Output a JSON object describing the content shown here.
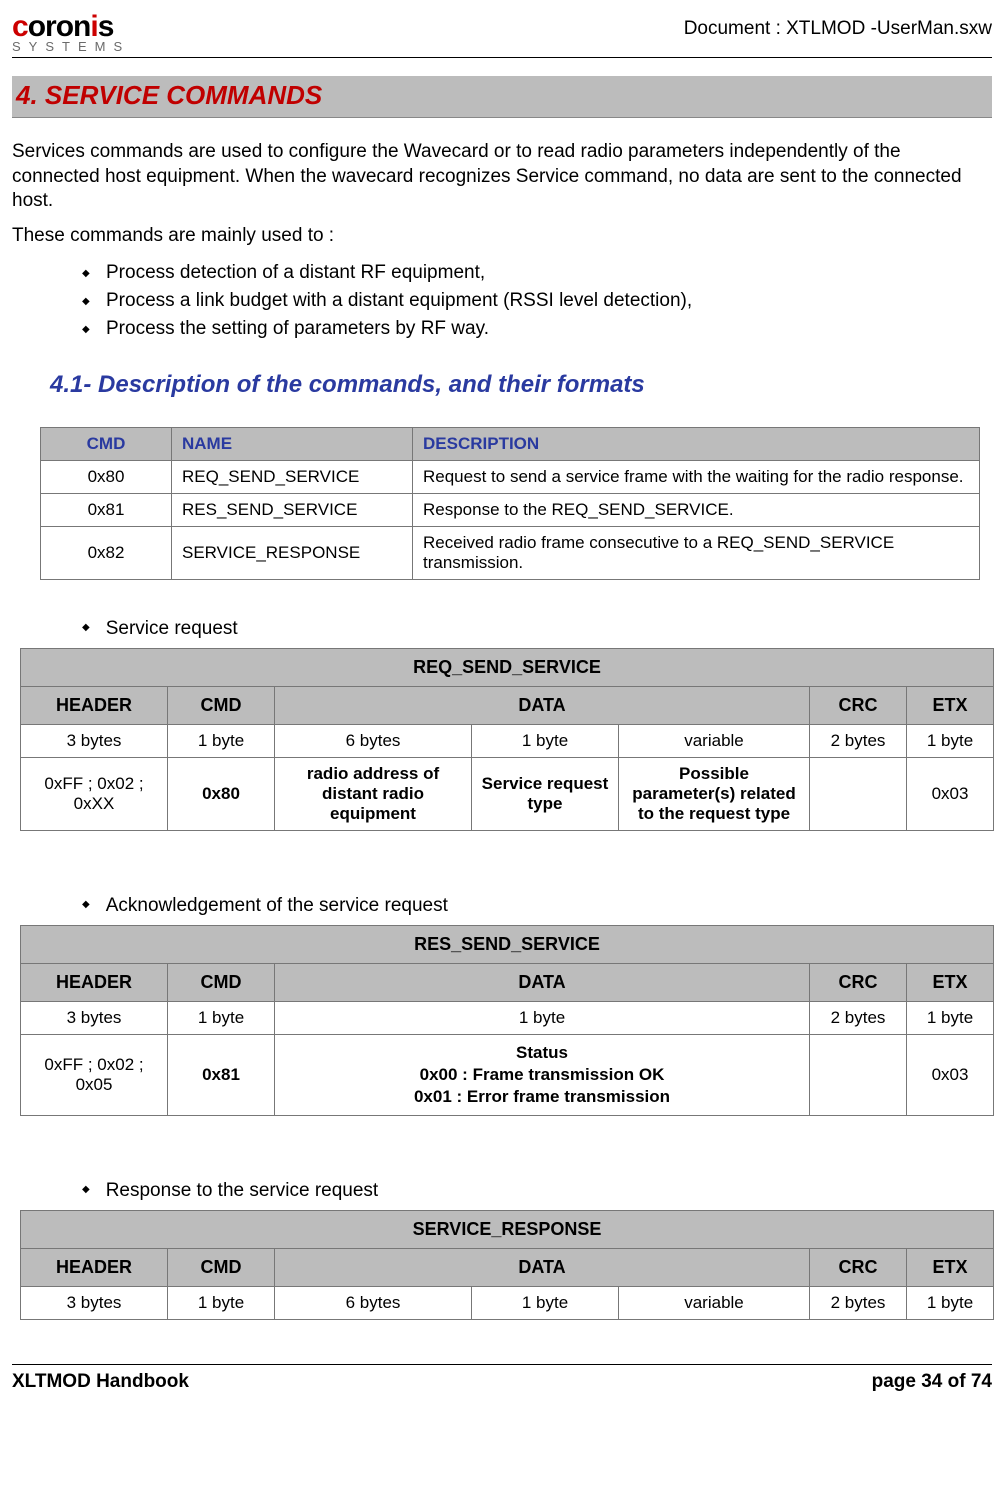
{
  "header": {
    "logo_main": "coronis",
    "logo_sub": "SYSTEMS",
    "docline": "Document : XTLMOD -UserMan.sxw"
  },
  "h1": "4. SERVICE COMMANDS",
  "intro_p1": "Services commands are used to configure the Wavecard or to read radio parameters independently of the connected host equipment. When the wavecard recognizes Service command, no data are sent to the connected host.",
  "intro_p2": "These commands are mainly used to :",
  "intro_list": [
    "Process detection of a distant RF equipment,",
    "Process a link budget with a distant equipment (RSSI level detection),",
    "Process the setting of parameters by RF way."
  ],
  "h2": "4.1- Description of the commands, and their formats",
  "t1": {
    "headers": {
      "cmd": "CMD",
      "name": "NAME",
      "desc": "DESCRIPTION"
    },
    "rows": [
      {
        "cmd": "0x80",
        "name": "REQ_SEND_SERVICE",
        "desc": "Request to send a service frame with the waiting for the radio response."
      },
      {
        "cmd": "0x81",
        "name": "RES_SEND_SERVICE",
        "desc": "Response to the REQ_SEND_SERVICE."
      },
      {
        "cmd": "0x82",
        "name": "SERVICE_RESPONSE",
        "desc": "Received radio frame consecutive to a REQ_SEND_SERVICE transmission."
      }
    ]
  },
  "sec_a": {
    "label": "Service request",
    "title": "REQ_SEND_SERVICE",
    "cols": [
      "HEADER",
      "CMD",
      "DATA",
      "CRC",
      "ETX"
    ],
    "row_sizes": [
      "3 bytes",
      "1 byte",
      "6 bytes",
      "1 byte",
      "variable",
      "2 bytes",
      "1 byte"
    ],
    "row_vals": [
      "0xFF ; 0x02 ; 0xXX",
      "0x80",
      "radio address of distant radio equipment",
      "Service request type",
      "Possible parameter(s) related to the request type",
      "",
      "0x03"
    ]
  },
  "sec_b": {
    "label": "Acknowledgement of the service request",
    "title": "RES_SEND_SERVICE",
    "cols": [
      "HEADER",
      "CMD",
      "DATA",
      "CRC",
      "ETX"
    ],
    "row_sizes": [
      "3 bytes",
      "1 byte",
      "1 byte",
      "2 bytes",
      "1 byte"
    ],
    "row_vals_header": "0xFF ; 0x02 ; 0x05",
    "row_vals_cmd": "0x81",
    "row_vals_status_t": "Status",
    "row_vals_status_1": "0x00 : Frame transmission OK",
    "row_vals_status_2": "0x01 : Error frame transmission",
    "row_vals_etx": "0x03"
  },
  "sec_c": {
    "label": "Response to the service request",
    "title": "SERVICE_RESPONSE",
    "cols": [
      "HEADER",
      "CMD",
      "DATA",
      "CRC",
      "ETX"
    ],
    "row_sizes": [
      "3 bytes",
      "1 byte",
      "6 bytes",
      "1 byte",
      "variable",
      "2 bytes",
      "1 byte"
    ]
  },
  "footer": {
    "left": "XLTMOD Handbook",
    "right": "page 34 of 74"
  }
}
